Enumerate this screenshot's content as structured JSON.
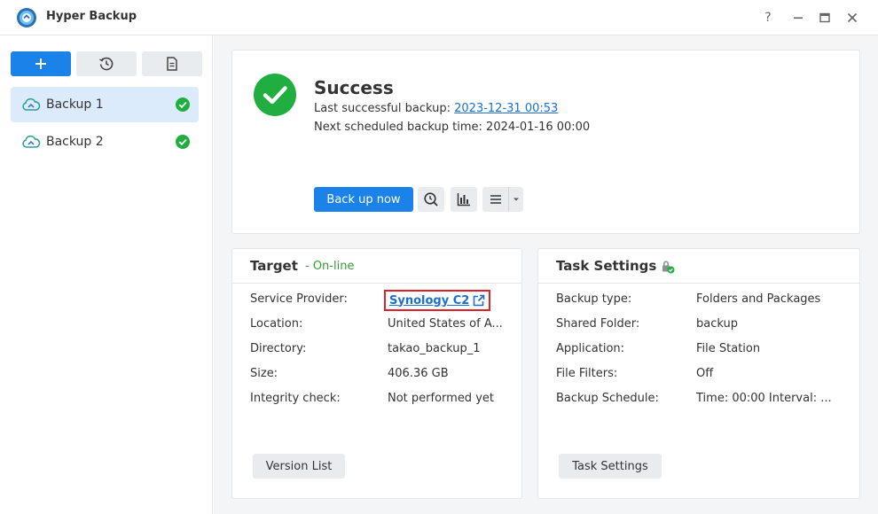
{
  "window": {
    "title": "Hyper Backup",
    "controls": {
      "help": "?",
      "minimize": "minimize",
      "maximize": "maximize",
      "close": "close"
    }
  },
  "sidebar": {
    "toolbar": [
      {
        "icon": "plus-icon"
      },
      {
        "icon": "history-icon"
      },
      {
        "icon": "log-icon"
      }
    ],
    "tasks": [
      {
        "label": "Backup 1",
        "active": true,
        "status": "success"
      },
      {
        "label": "Backup 2",
        "active": false,
        "status": "success"
      }
    ]
  },
  "status": {
    "title": "Success",
    "last_backup_label": "Last successful backup:",
    "last_backup_value": "2023-12-31 00:53",
    "next_backup_text": "Next scheduled backup time: 2024-01-16 00:00",
    "backup_now_label": "Back up now",
    "accent_color": "#1a82e8",
    "success_color": "#1fae3f"
  },
  "target": {
    "title": "Target",
    "online_text": "- On-line",
    "rows": [
      {
        "label": "Service Provider:",
        "value": "Synology C2"
      },
      {
        "label": "Location:",
        "value": "United States of A..."
      },
      {
        "label": "Directory:",
        "value": "takao_backup_1"
      },
      {
        "label": "Size:",
        "value": "406.36 GB"
      },
      {
        "label": "Integrity check:",
        "value": "Not performed yet"
      }
    ],
    "button_label": "Version List"
  },
  "settings": {
    "title": "Task Settings",
    "rows": [
      {
        "label": "Backup type:",
        "value": "Folders and Packages"
      },
      {
        "label": "Shared Folder:",
        "value": "backup"
      },
      {
        "label": "Application:",
        "value": "File Station"
      },
      {
        "label": "File Filters:",
        "value": "Off"
      },
      {
        "label": "Backup Schedule:",
        "value": "Time: 00:00 Interval: ..."
      }
    ],
    "button_label": "Task Settings"
  }
}
